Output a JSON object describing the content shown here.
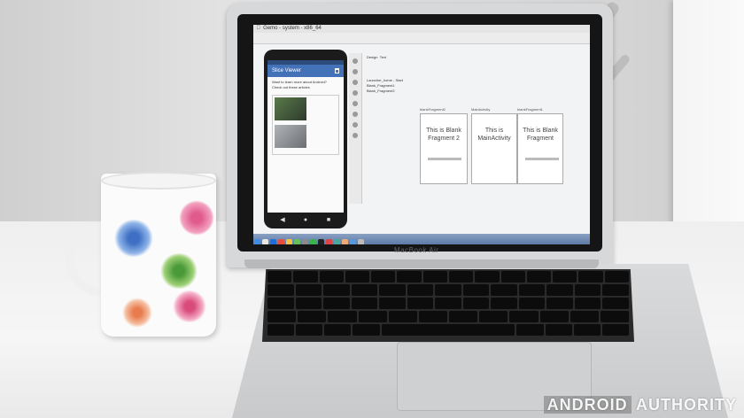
{
  "scene": {
    "laptop_brand": "MacBook Air",
    "watermark": {
      "part1": "ANDROID",
      "part2": "AUTHORITY"
    }
  },
  "screen": {
    "window_title": "Gemo - system - x86_64",
    "fragments": [
      {
        "label": "blankFragment2",
        "text": "This is Blank Fragment 2"
      },
      {
        "label": "MainActivity",
        "text": "This is MainActivity"
      },
      {
        "label": "blankFragment1",
        "text": "This is Blank Fragment"
      }
    ],
    "tree_items": [
      "Launcher_home - Start",
      "Blank_Fragment1",
      "Blank_Fragment2"
    ],
    "editor_tabs": [
      "Design",
      "Text"
    ]
  },
  "phone": {
    "appbar_title": "Slice Viewer",
    "text_line1": "Want to learn more about Android?",
    "text_line2": "Check out these articles"
  },
  "colors": {
    "appbar": "#4472b8",
    "statusbar": "#2c4c7c",
    "dock": "#5e7aa6"
  }
}
